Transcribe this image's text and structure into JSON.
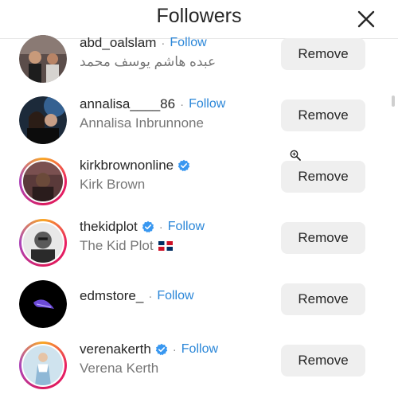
{
  "header": {
    "title": "Followers"
  },
  "follow_label": "Follow",
  "remove_label": "Remove",
  "followers": [
    {
      "username": "abd_oalslam",
      "name": "عبده هاشم يوسف محمد",
      "verified": false,
      "show_follow": true
    },
    {
      "username": "annalisa____86",
      "name": "Annalisa Inbrunnone",
      "verified": false,
      "show_follow": true
    },
    {
      "username": "kirkbrownonline",
      "name": "Kirk Brown",
      "verified": true,
      "show_follow": false
    },
    {
      "username": "thekidplot",
      "name": "The Kid Plot",
      "verified": true,
      "show_follow": true,
      "flag": "dominican-republic"
    },
    {
      "username": "edmstore_",
      "name": "",
      "verified": false,
      "show_follow": true
    },
    {
      "username": "verenakerth",
      "name": "Verena Kerth",
      "verified": true,
      "show_follow": true
    }
  ],
  "icons": {
    "close": "close-icon",
    "verified": "verified-badge-icon",
    "zoom": "zoom-in-icon"
  },
  "colors": {
    "follow_link": "#2a86d8",
    "verified": "#3897f0",
    "remove_bg": "#efefef"
  }
}
